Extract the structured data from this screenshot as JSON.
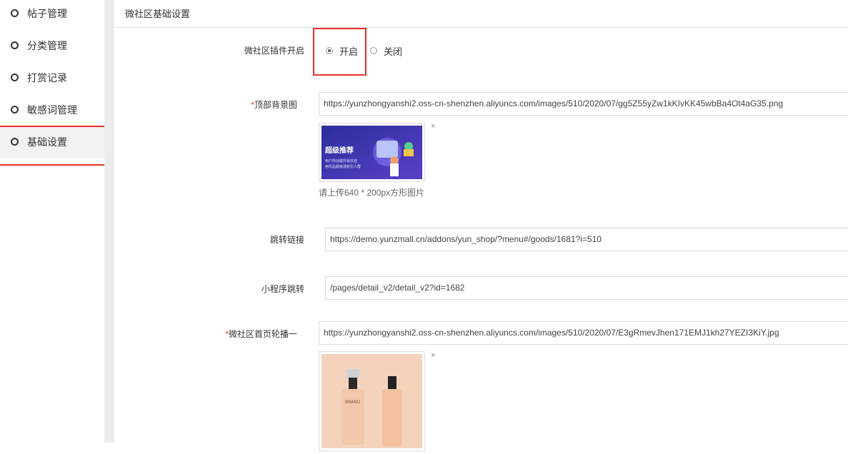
{
  "sidebar": {
    "items": [
      {
        "label": "帖子管理"
      },
      {
        "label": "分类管理"
      },
      {
        "label": "打赏记录"
      },
      {
        "label": "敏感词管理"
      },
      {
        "label": "基础设置"
      }
    ]
  },
  "panel": {
    "title": "微社区基础设置"
  },
  "form": {
    "plugin": {
      "label": "微社区插件开启",
      "on_label": "开启",
      "off_label": "关闭",
      "selected": "开启"
    },
    "header_bg": {
      "required_mark": "*",
      "label": "顶部背景图",
      "value": "https://yunzhongyanshi2.oss-cn-shenzhen.aliyuncs.com/images/510/2020/07/gg5Z55yZw1kKIvKK45wbBa4Ot4aG35.png",
      "thumb_title": "超级推荐",
      "thumb_line1": "用户所创建并受欢迎",
      "thumb_line2": "用优品超级涨粉引人群",
      "hint": "请上传640 * 200px方形图片",
      "close_glyph": "×"
    },
    "jump_link": {
      "label": "跳转链接",
      "value": "https://demo.yunzmall.cn/addons/yun_shop/?menu#/goods/1681?i=510"
    },
    "mini_program": {
      "label": "小程序跳转",
      "value": "/pages/detail_v2/detail_v2?id=1682"
    },
    "banner1": {
      "required_mark": "*",
      "label": "微社区首页轮播一",
      "value": "https://yunzhongyanshi2.oss-cn-shenzhen.aliyuncs.com/images/510/2020/07/E3gRmevJhen171EMJ1kh27YEZI3KiY.jpg",
      "thumb_brand": "BRAND",
      "close_glyph": "×"
    }
  },
  "colors": {
    "highlight": "#e5322d",
    "sidebar_active_bg": "#f2f2f2",
    "border": "#d9d9d9"
  }
}
